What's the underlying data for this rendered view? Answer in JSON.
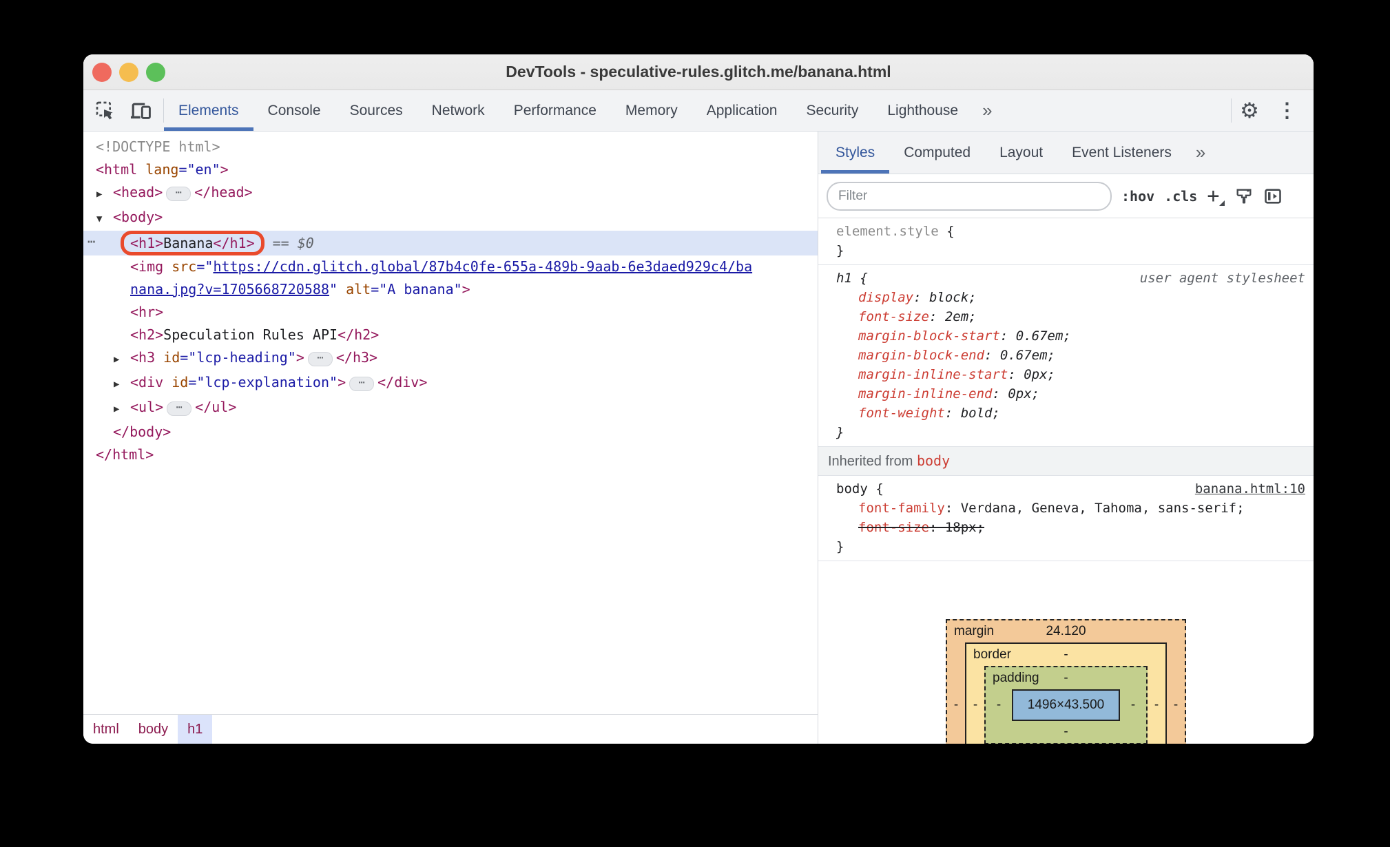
{
  "window": {
    "title": "DevTools - speculative-rules.glitch.me/banana.html"
  },
  "titlebar_buttons": [
    "close",
    "minimize",
    "zoom"
  ],
  "main_tabs": {
    "items": [
      "Elements",
      "Console",
      "Sources",
      "Network",
      "Performance",
      "Memory",
      "Application",
      "Security",
      "Lighthouse"
    ],
    "active": "Elements",
    "overflow": "»"
  },
  "toolbar_icons": [
    "inspect-icon",
    "device-toolbar-icon",
    "settings-gear-icon",
    "more-options-icon"
  ],
  "dom_tree": {
    "rows": [
      {
        "indent": 0,
        "segments": [
          [
            "gray",
            "<!DOCTYPE html>"
          ]
        ]
      },
      {
        "indent": 0,
        "segments": [
          [
            "tag",
            "<html"
          ],
          [
            "plain",
            " "
          ],
          [
            "attr",
            "lang"
          ],
          [
            "val",
            "=\"en\""
          ],
          [
            "tag",
            ">"
          ]
        ]
      },
      {
        "indent": 1,
        "arrow": "right",
        "segments": [
          [
            "tag",
            "<head>"
          ],
          [
            "pill",
            "⋯"
          ],
          [
            "tag",
            "</head>"
          ]
        ]
      },
      {
        "indent": 1,
        "arrow": "down",
        "segments": [
          [
            "tag",
            "<body>"
          ]
        ]
      },
      {
        "indent": 2,
        "selected": true,
        "gutter": "⋯",
        "ring": [
          [
            "tag",
            "<h1>"
          ],
          [
            "text",
            "Banana"
          ],
          [
            "tag",
            "</h1>"
          ]
        ],
        "segments": [
          [
            "meta",
            "== $0"
          ]
        ]
      },
      {
        "indent": 2,
        "lines": [
          [
            [
              "tag",
              "<img"
            ],
            [
              "plain",
              " "
            ],
            [
              "attr",
              "src"
            ],
            [
              "val",
              "=\""
            ],
            [
              "link",
              "https://cdn.glitch.global/87b4c0fe-655a-489b-9aab-6e3daed929c4/ba"
            ]
          ],
          [
            [
              "link",
              "nana.jpg?v=1705668720588"
            ],
            [
              "val",
              "\""
            ],
            [
              "plain",
              " "
            ],
            [
              "attr",
              "alt"
            ],
            [
              "val",
              "=\"A banana\""
            ],
            [
              "tag",
              ">"
            ]
          ]
        ]
      },
      {
        "indent": 2,
        "segments": [
          [
            "tag",
            "<hr>"
          ]
        ]
      },
      {
        "indent": 2,
        "segments": [
          [
            "tag",
            "<h2>"
          ],
          [
            "text",
            "Speculation Rules API"
          ],
          [
            "tag",
            "</h2>"
          ]
        ]
      },
      {
        "indent": 2,
        "arrow": "right",
        "segments": [
          [
            "tag",
            "<h3"
          ],
          [
            "plain",
            " "
          ],
          [
            "attr",
            "id"
          ],
          [
            "val",
            "=\"lcp-heading\""
          ],
          [
            "tag",
            ">"
          ],
          [
            "pill",
            "⋯"
          ],
          [
            "tag",
            "</h3>"
          ]
        ]
      },
      {
        "indent": 2,
        "arrow": "right",
        "segments": [
          [
            "tag",
            "<div"
          ],
          [
            "plain",
            " "
          ],
          [
            "attr",
            "id"
          ],
          [
            "val",
            "=\"lcp-explanation\""
          ],
          [
            "tag",
            ">"
          ],
          [
            "pill",
            "⋯"
          ],
          [
            "tag",
            "</div>"
          ]
        ]
      },
      {
        "indent": 2,
        "arrow": "right",
        "segments": [
          [
            "tag",
            "<ul>"
          ],
          [
            "pill",
            "⋯"
          ],
          [
            "tag",
            "</ul>"
          ]
        ]
      },
      {
        "indent": 1,
        "segments": [
          [
            "tag",
            "</body>"
          ]
        ]
      },
      {
        "indent": 0,
        "segments": [
          [
            "tag",
            "</html>"
          ]
        ]
      }
    ]
  },
  "breadcrumbs": {
    "items": [
      "html",
      "body",
      "h1"
    ],
    "active": "h1"
  },
  "styles_sidebar": {
    "tabs": [
      "Styles",
      "Computed",
      "Layout",
      "Event Listeners"
    ],
    "active": "Styles",
    "overflow": "»",
    "filter_placeholder": "Filter",
    "controls": {
      "hover": ":hov",
      "classes": ".cls",
      "new_rule": "+"
    },
    "sections": [
      {
        "type": "rule",
        "italic": false,
        "selector": [
          [
            "gray",
            "element.style"
          ],
          [
            "plain",
            " {"
          ]
        ],
        "props": [],
        "close": "}"
      },
      {
        "type": "rule",
        "italic": true,
        "selector": [
          [
            "plain",
            "h1 {"
          ]
        ],
        "origin": {
          "text": "user agent stylesheet",
          "link": false
        },
        "props": [
          {
            "n": "display",
            "v": "block"
          },
          {
            "n": "font-size",
            "v": "2em"
          },
          {
            "n": "margin-block-start",
            "v": "0.67em"
          },
          {
            "n": "margin-block-end",
            "v": "0.67em"
          },
          {
            "n": "margin-inline-start",
            "v": "0px"
          },
          {
            "n": "margin-inline-end",
            "v": "0px"
          },
          {
            "n": "font-weight",
            "v": "bold"
          }
        ],
        "close": "}"
      },
      {
        "type": "header",
        "text": "Inherited from ",
        "link": "body"
      },
      {
        "type": "rule",
        "italic": false,
        "selector": [
          [
            "plain",
            "body {"
          ]
        ],
        "origin": {
          "text": "banana.html:10",
          "link": true
        },
        "props": [
          {
            "n": "font-family",
            "v": "Verdana, Geneva, Tahoma, sans-serif"
          },
          {
            "n": "font-size",
            "v": "18px",
            "struck": true
          }
        ],
        "close": "}"
      }
    ]
  },
  "box_model": {
    "margin_label": "margin",
    "margin_top": "24.120",
    "border_label": "border",
    "padding_label": "padding",
    "content": "1496×43.500",
    "dash": "-"
  },
  "colors": {
    "accent_blue": "#33569b",
    "accent_underline": "#4d74b8",
    "tag": "#94185c",
    "attr_name": "#994500",
    "attr_value": "#1a1aa6",
    "prop_name": "#cc3d33",
    "selected_row": "#dbe4f7",
    "ring_orange": "#e94a2c",
    "breadcrumb_text": "#8b1a4e",
    "breadcrumb_active_bg": "#dbe3fb",
    "box_margin": "#f3c999",
    "box_border": "#fbe3a3",
    "box_padding": "#c3cf8d",
    "box_content": "#92b9d9"
  }
}
